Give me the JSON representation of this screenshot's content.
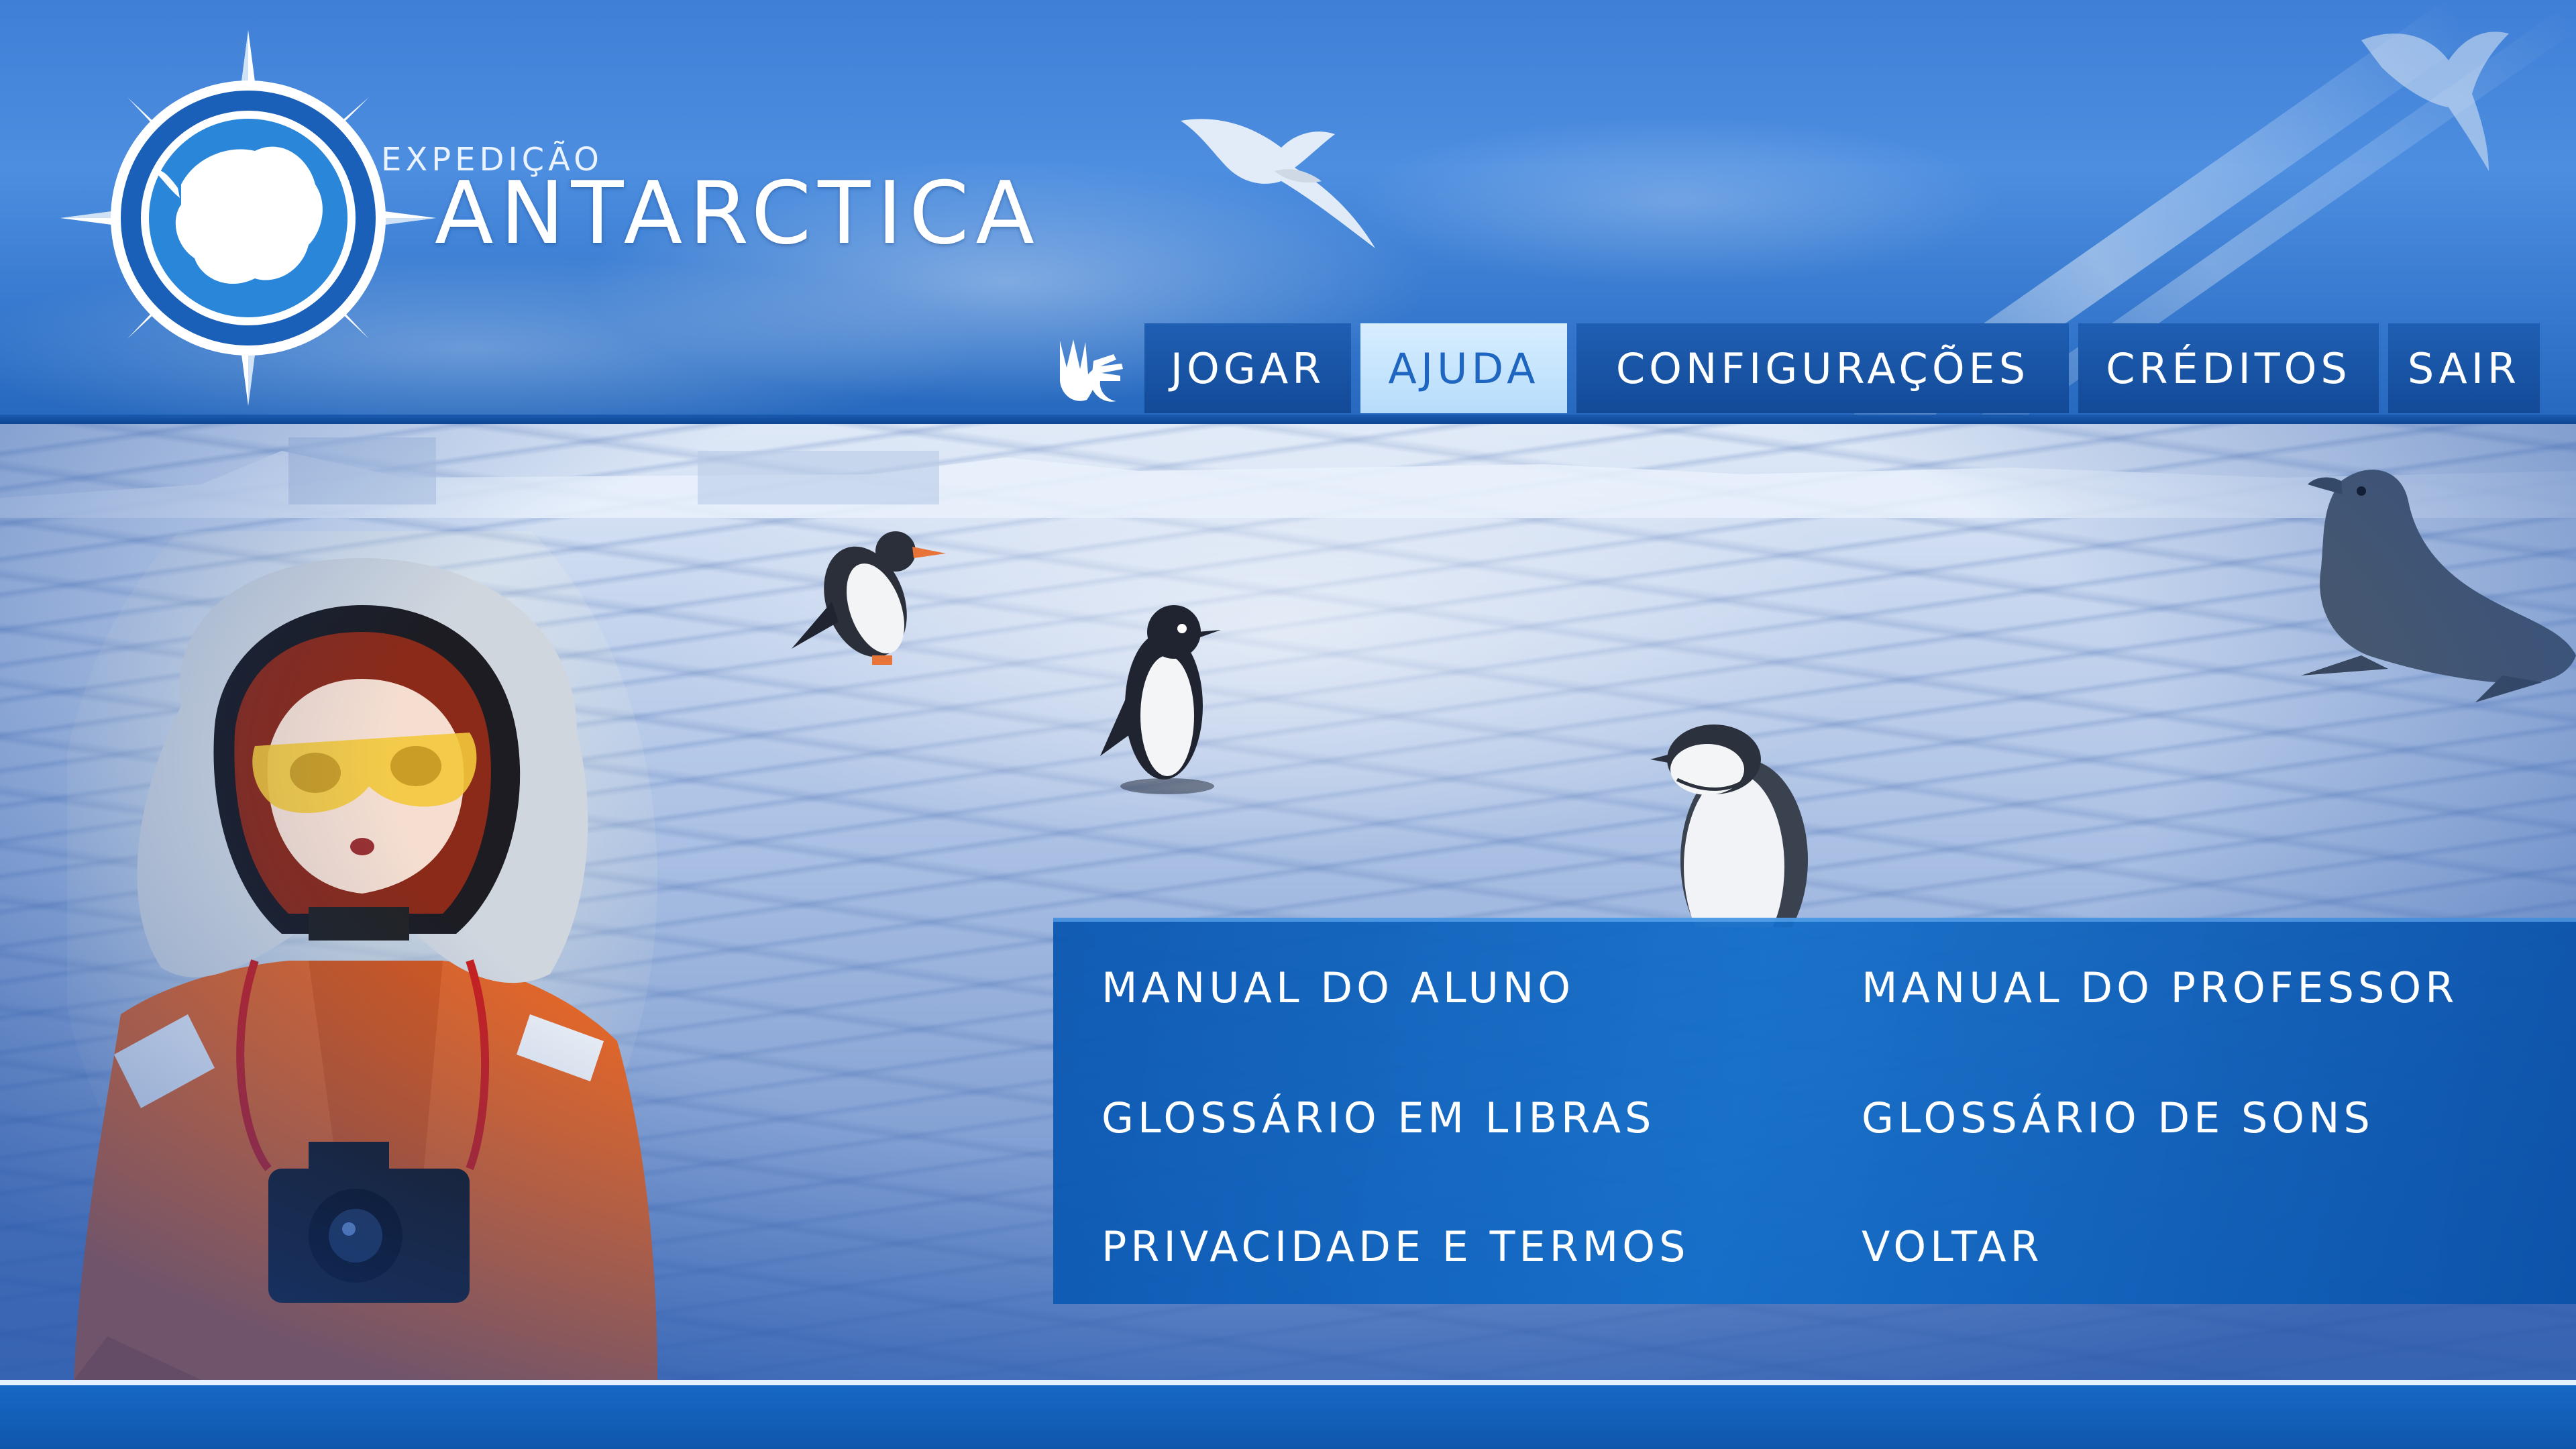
{
  "logo": {
    "subtitle": "EXPEDIÇÃO",
    "title": "ANTARCTICA"
  },
  "nav": {
    "libras_icon": "sign-language-hands-icon",
    "items": [
      {
        "label": "JOGAR",
        "active": false
      },
      {
        "label": "AJUDA",
        "active": true
      },
      {
        "label": "CONFIGURAÇÕES",
        "active": false
      },
      {
        "label": "CRÉDITOS",
        "active": false
      },
      {
        "label": "SAIR",
        "active": false
      }
    ]
  },
  "help_menu": {
    "items": [
      "MANUAL DO ALUNO",
      "MANUAL DO PROFESSOR",
      "GLOSSÁRIO EM LIBRAS",
      "GLOSSÁRIO DE SONS",
      "PRIVACIDADE E TERMOS",
      "VOLTAR"
    ]
  },
  "colors": {
    "sky": "#3f7fd6",
    "nav_button": "#1f5fb3",
    "nav_active_bg": "#c8e6ff",
    "nav_active_text": "#1f66c0",
    "panel": "#0c58b2",
    "footer": "#1668c4"
  }
}
